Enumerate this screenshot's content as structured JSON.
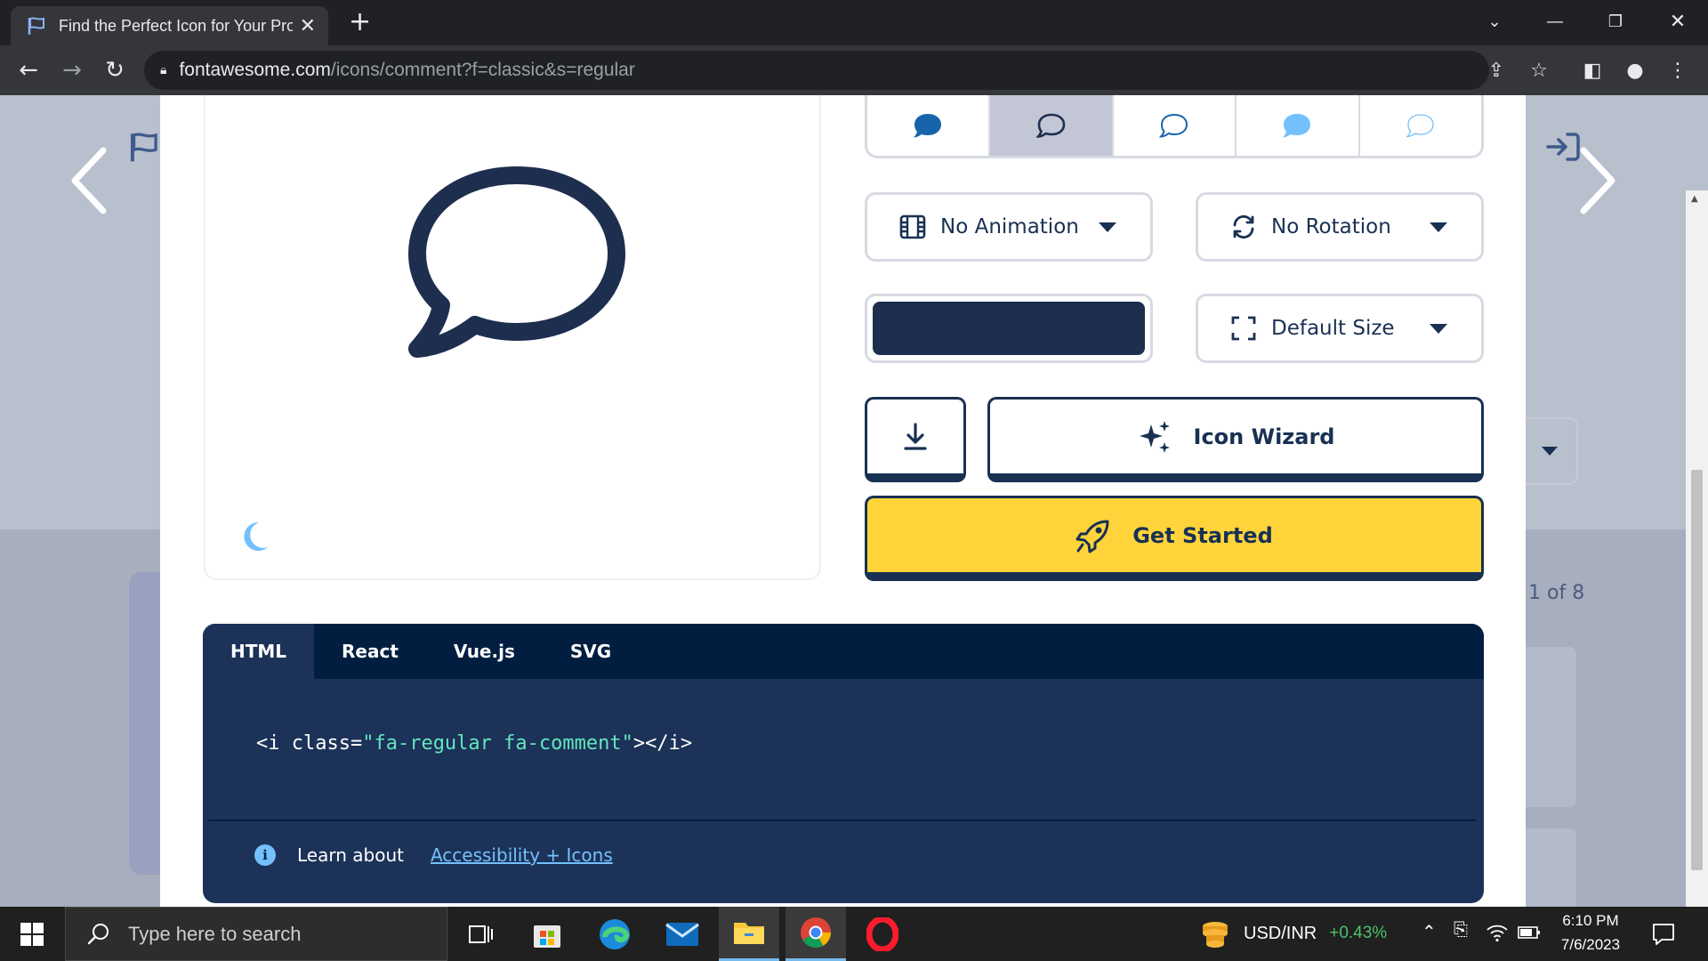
{
  "browser": {
    "tab_title": "Find the Perfect Icon for Your Pro",
    "url_host": "fontawesome.com",
    "url_path": "/icons/comment?f=classic&s=regular"
  },
  "page": {
    "animation_select": "No Animation",
    "rotation_select": "No Rotation",
    "size_select": "Default Size",
    "color_value": "#1e2e4f",
    "icon_wizard_label": "Icon Wizard",
    "get_started_label": "Get Started",
    "pager_text": "1 of 8",
    "code_tabs": [
      "HTML",
      "React",
      "Vue.js",
      "SVG"
    ],
    "code": {
      "open": "<i class=",
      "value": "\"fa-regular fa-comment\"",
      "close": "></i>"
    },
    "learn_text": "Learn about",
    "learn_link": "Accessibility + Icons"
  },
  "taskbar": {
    "search_placeholder": "Type here to search",
    "ticker_symbol": "USD/INR",
    "ticker_change": "+0.43%",
    "time": "6:10 PM",
    "date": "7/6/2023"
  },
  "colors": {
    "brand_navy": "#183153",
    "code_bg": "#1c3258",
    "yellow": "#ffd43b",
    "link_blue": "#74c0fc"
  }
}
